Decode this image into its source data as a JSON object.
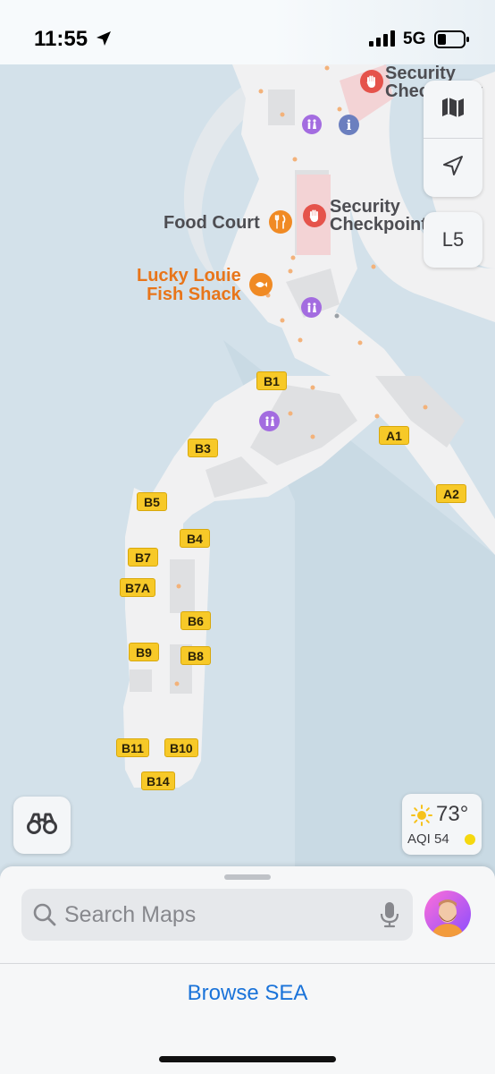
{
  "status_bar": {
    "time": "11:55",
    "network": "5G"
  },
  "map": {
    "labels": {
      "security_top": "Security\nCheckpoint",
      "security_mid": "Security\nCheckpoint",
      "food_court": "Food Court",
      "lucky_louie": "Lucky Louie\nFish Shack"
    },
    "gates": [
      "B1",
      "B3",
      "A1",
      "A2",
      "B5",
      "B4",
      "B7",
      "B7A",
      "B6",
      "B9",
      "B8",
      "B11",
      "B10",
      "B14"
    ],
    "colors": {
      "water": "#d3e1ea",
      "terminal": "#f1f1f2",
      "gate_label": "#f7c928",
      "restroom": "#a36ce0",
      "security": "#e5534b",
      "food": "#f08a24",
      "info": "#6b7fbf"
    },
    "icons": [
      "restroom-icon",
      "info-icon",
      "security-hand-icon",
      "fork-knife-icon",
      "fish-icon"
    ]
  },
  "controls": {
    "map_mode_icon": "map-icon",
    "location_icon": "location-arrow-icon",
    "level": "L5",
    "lookaround_icon": "binoculars-icon"
  },
  "weather": {
    "temperature": "73°",
    "aqi": "AQI 54",
    "icon": "sun-icon"
  },
  "sheet": {
    "search_placeholder": "Search Maps",
    "browse_label": "Browse SEA"
  }
}
